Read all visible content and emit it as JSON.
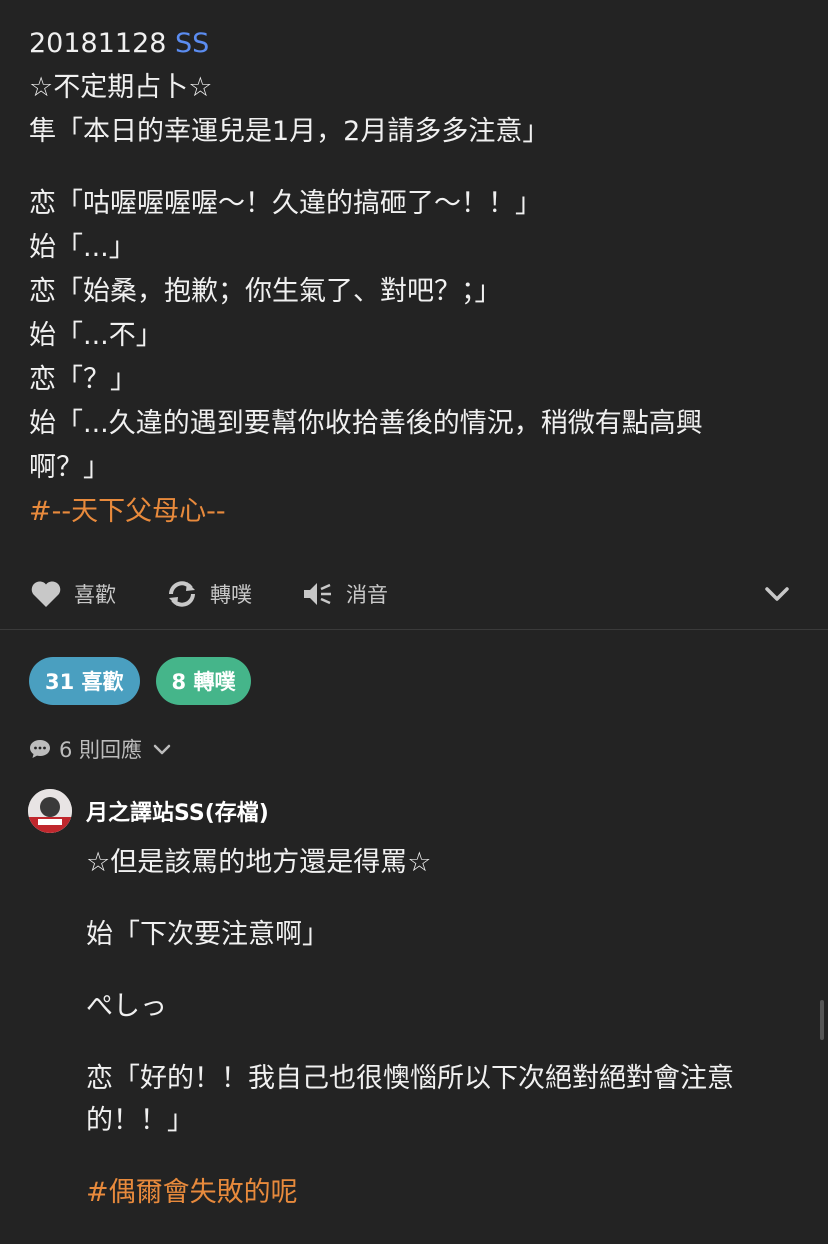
{
  "post": {
    "date": "20181128",
    "link": "SS",
    "lines1": [
      "☆不定期占卜☆",
      "隼「本日的幸運兒是1月，2月請多多注意」"
    ],
    "lines2": [
      "恋「咕喔喔喔喔～！久違的搞砸了～！！」",
      "始「...」",
      "恋「始桑，抱歉；你生氣了、對吧？；」",
      "始「...不」",
      "恋「？」",
      "始「...久違的遇到要幫你收拾善後的情況，稍微有點高興",
      "啊？」"
    ],
    "hashtag": "#--天下父母心--"
  },
  "actions": {
    "like": "喜歡",
    "replurk": "轉噗",
    "mute": "消音"
  },
  "stats": {
    "likes": "31 喜歡",
    "replurks": "8 轉噗"
  },
  "responses": {
    "count_label": "6 則回應"
  },
  "reply": {
    "username": "月之譯站SS(存檔)",
    "paragraphs": [
      "☆但是該罵的地方還是得罵☆",
      "始「下次要注意啊」",
      "ぺしっ",
      "恋「好的！！我自己也很懊惱所以下次絕對絕對會注意的！！」"
    ],
    "hashtag": "#偶爾會失敗的呢"
  },
  "colors": {
    "background": "#232323",
    "link": "#5b8cf0",
    "hashtag": "#e88a3c",
    "like_badge": "#4a9fc0",
    "replurk_badge": "#45b58a"
  }
}
